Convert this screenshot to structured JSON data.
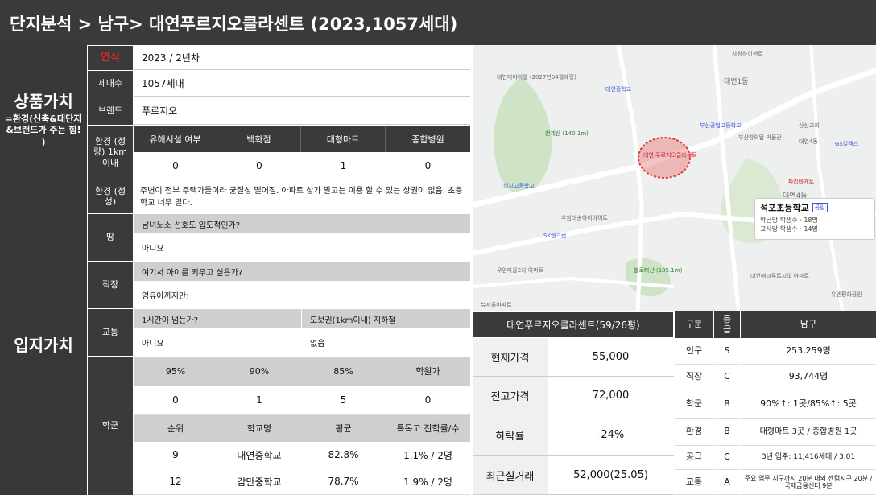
{
  "header": {
    "title": "단지분석 > 남구> 대연푸르지오클라센트 (2023,1057세대)"
  },
  "product": {
    "section_label": "상품가치",
    "section_sub": "=환경(신축&대단지&브랜드가 주는 힘! )",
    "year_label": "연식",
    "year_value": "2023 / 2년차",
    "units_label": "세대수",
    "units_value": "1057세대",
    "brand_label": "브랜드",
    "brand_value": "푸르지오",
    "env_quant_label": "환경 (정량) 1km이내",
    "env_headers": [
      "유해시설 여부",
      "백화점",
      "대형마트",
      "종합병원"
    ],
    "env_values": [
      "0",
      "0",
      "1",
      "0"
    ],
    "env_qual_label": "환경 (정성)",
    "env_qual_text": "주변이 전부 주택가들이라 균질성 떨어짐. 아파트 상가 말고는 이용 할 수 있는 상권이 없음. 초등학교 너무 멀다."
  },
  "location": {
    "section_label": "입지가치",
    "land_label": "땅",
    "land_q": "남녀노소 선호도 압도적인가?",
    "land_a": "아니요",
    "job_label": "직장",
    "job_q": "여기서 아이를 키우고 싶은가?",
    "job_a": "영유아까지만!",
    "traffic_label": "교통",
    "traffic_q1": "1시간이 넘는가?",
    "traffic_q2": "도보권(1km이내) 지하철",
    "traffic_a1": "아니요",
    "traffic_a2": "없음",
    "school_label": "학군",
    "school_pct_headers": [
      "95%",
      "90%",
      "85%",
      "학원가"
    ],
    "school_pct_values": [
      "0",
      "1",
      "5",
      "0"
    ],
    "school_headers": [
      "순위",
      "학교명",
      "평균",
      "특목고 진학률/수"
    ],
    "school_rows": [
      [
        "9",
        "대연중학교",
        "82.8%",
        "1.1% / 2명"
      ],
      [
        "12",
        "감만중학교",
        "78.7%",
        "1.9% / 2명"
      ]
    ]
  },
  "map": {
    "labels": [
      "대연디아이엘 (2027년04월예정)",
      "대연중학교",
      "천제산 (140.1m)",
      "대연 푸르지오클라센트",
      "성지고등학교",
      "우암대송하이아이트",
      "SK랜크런",
      "우암마을2차 아파트",
      "뉴서울아파트",
      "불로터산 (105.1m)",
      "대연1동",
      "부산공업고등학교",
      "부산창의탑 박물관",
      "상심교회",
      "대연4동",
      "GS칼텍스",
      "파리바게트",
      "대연4동",
      "석포초등학교",
      "학급당 학생수 · 18명",
      "교사당 학생수 · 14명",
      "대연해크푸르지오 아파트",
      "유엔평화공원",
      "사랑하이센트"
    ],
    "school_badge": "공립"
  },
  "price": {
    "title": "대연푸르지오클라센트(59/26평)",
    "rows": [
      [
        "현재가격",
        "55,000"
      ],
      [
        "전고가격",
        "72,000"
      ],
      [
        "하락률",
        "-24%"
      ],
      [
        "최근실거래",
        "52,000(25.05)"
      ]
    ]
  },
  "grade": {
    "headers": [
      "구분",
      "등급",
      "남구"
    ],
    "rows": [
      [
        "인구",
        "S",
        "253,259명"
      ],
      [
        "직장",
        "C",
        "93,744명"
      ],
      [
        "학군",
        "B",
        "90%↑: 1곳/85%↑: 5곳"
      ],
      [
        "환경",
        "B",
        "대형마트 3곳 / 종합병원 1곳"
      ],
      [
        "공급",
        "C",
        "3년 입주: 11,416세대 / 3.01"
      ],
      [
        "교통",
        "A",
        "주요 업무 지구까지 20분 내외 센텀지구 20분 / 국제금융센터 9분"
      ]
    ]
  },
  "colors": {
    "year_label": "#e8232a",
    "header_bg": "#3a3a3a",
    "gray_row": "#cfcfcf",
    "target_circle": "#e53935"
  }
}
